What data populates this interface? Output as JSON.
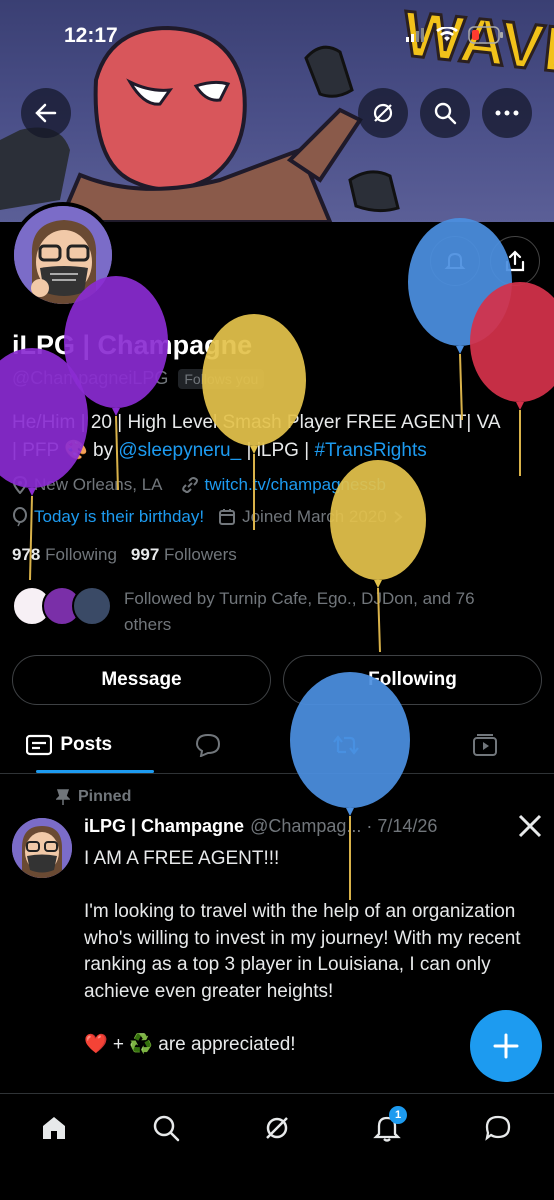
{
  "status_bar": {
    "time": "12:17"
  },
  "header": {
    "back": "back",
    "grok": "grok",
    "search": "search",
    "more": "more"
  },
  "profile": {
    "name": "iLPG | Champagne",
    "handle": "@ChampagneiLPG",
    "follows_you": "Follows you",
    "bio_line1": "He/Him | 20 | High Level Smash Player FREE AGENT| VA",
    "bio_line2_pre": "| PFP 🎨 by ",
    "bio_link1": "@sleepyneru_",
    "bio_mid": " | iLPG | ",
    "bio_link2": "#TransRights",
    "location": "New Orleans, LA",
    "website": "twitch.tv/champagnessb",
    "birthday": "Today is their birthday!",
    "joined": "Joined March 2020",
    "following_count": "978",
    "following_label": "Following",
    "followers_count": "997",
    "followers_label": "Followers",
    "followed_by": "Followed by Turnip Cafe, Ego., DJDon, and 76 others"
  },
  "buttons": {
    "message": "Message",
    "following": "Following"
  },
  "tabs": {
    "posts": "Posts"
  },
  "post": {
    "pinned_label": "Pinned",
    "author": "iLPG | Champagne",
    "handle_date": "@Champag... · 7/14/26",
    "body": "I AM A FREE AGENT!!!\n\nI'm looking to travel with the help of an organization who's willing to invest in my journey! With my recent ranking as a top 3 player in Louisiana, I can only achieve even greater heights!\n\n❤️ + ♻️ are appreciated!"
  },
  "banner": {
    "text": "WAVE"
  },
  "notifications_badge": "1",
  "colors": {
    "accent": "#1d9bf0",
    "bg": "#000000",
    "muted": "#71767b"
  },
  "icons": [
    "back-icon",
    "grok-icon",
    "search-icon",
    "more-icon",
    "share-icon",
    "bell-icon",
    "location-icon",
    "link-icon",
    "balloon-icon",
    "calendar-icon",
    "pin-icon",
    "x-logo-icon",
    "home-icon",
    "notification-icon",
    "message-icon",
    "compose-icon"
  ]
}
